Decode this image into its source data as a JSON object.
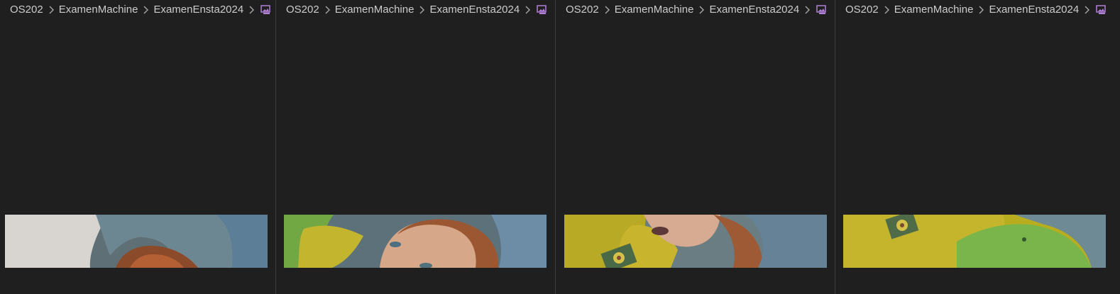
{
  "breadcrumb": {
    "segments": [
      "OS202",
      "ExamenMachine",
      "ExamenEnsta2024"
    ],
    "separator_icon": "chevron-right-icon",
    "file_icon": "image-file-icon",
    "file_icon_color": "#b180d7"
  },
  "theme": {
    "background": "#1f1f1f",
    "divider": "#3c3c3c",
    "text": "#cccccc"
  },
  "panes": [
    {
      "name": "pane-1",
      "preview_description": "photo strip"
    },
    {
      "name": "pane-2",
      "preview_description": "photo strip"
    },
    {
      "name": "pane-3",
      "preview_description": "photo strip"
    },
    {
      "name": "pane-4",
      "preview_description": "photo strip"
    }
  ]
}
